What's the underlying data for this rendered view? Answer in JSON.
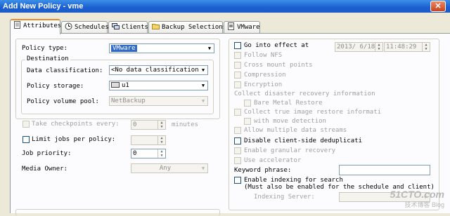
{
  "window": {
    "title": "Add New Policy - vme"
  },
  "tabs": [
    {
      "label": "Attributes"
    },
    {
      "label": "Schedules"
    },
    {
      "label": "Clients"
    },
    {
      "label": "Backup Selections"
    },
    {
      "label": "VMware"
    }
  ],
  "left": {
    "policy_type": {
      "label": "Policy type:",
      "value": "VMware"
    },
    "destination": {
      "label": "Destination",
      "data_classification": {
        "label": "Data classification:",
        "value": "<No data classification>"
      },
      "policy_storage": {
        "label": "Policy storage:",
        "value": "u1"
      },
      "volume_pool": {
        "label": "Policy volume pool:",
        "value": "NetBackup"
      }
    },
    "checkpoints": {
      "label": "Take checkpoints every:",
      "value": "0",
      "unit": "minutes"
    },
    "limit_jobs": {
      "label": "Limit jobs per policy:"
    },
    "job_priority": {
      "label": "Job priority:",
      "value": "0"
    },
    "media_owner": {
      "label": "Media Owner:",
      "value": "Any"
    }
  },
  "right": {
    "go_into_effect": {
      "label": "Go into effect at",
      "date": "2013/ 6/18",
      "time": "11:48:29"
    },
    "options": [
      {
        "label": "Follow NFS"
      },
      {
        "label": "Cross mount points"
      },
      {
        "label": "Compression"
      },
      {
        "label": "Encryption"
      }
    ],
    "disaster_recovery": {
      "label": "Collect disaster recovery information"
    },
    "bare_metal": {
      "label": "Bare Metal Restore"
    },
    "true_image": {
      "label": "Collect true image restore informati"
    },
    "move_detection": {
      "label": "with move detection"
    },
    "multiple_streams": {
      "label": "Allow multiple data streams"
    },
    "disable_dedup": {
      "label": "Disable client-side deduplicati"
    },
    "granular": {
      "label": "Enable granular recovery"
    },
    "accelerator": {
      "label": "Use accelerator"
    },
    "keyword": {
      "label": "Keyword phrase:"
    },
    "indexing": {
      "label": "Enable indexing for search",
      "note": "(Must also be enabled for the schedule and client)"
    },
    "indexing_server": {
      "label": "Indexing Server:"
    }
  },
  "watermark": {
    "line1": "51CTO.com",
    "line2": "技术博客  Blog"
  }
}
